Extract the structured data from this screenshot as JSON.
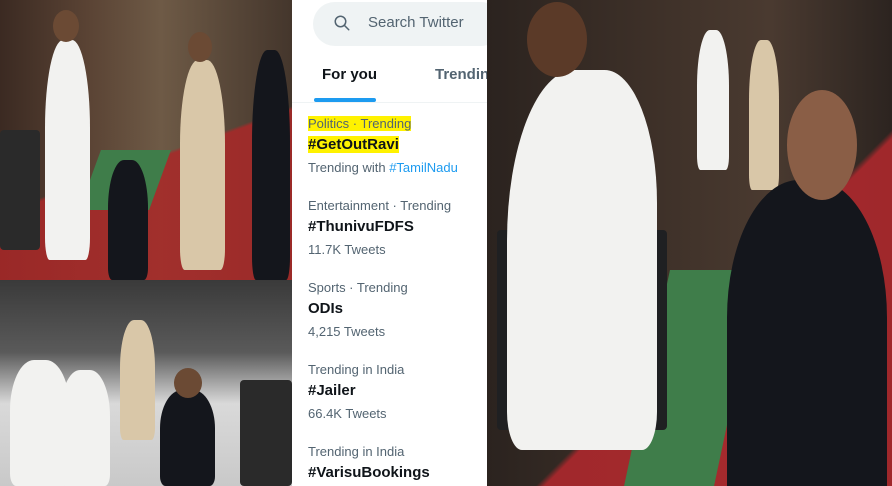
{
  "search": {
    "placeholder": "Search Twitter",
    "icon": "search-icon"
  },
  "tabs": [
    {
      "label": "For you",
      "active": true
    },
    {
      "label": "Trendin",
      "active": false
    }
  ],
  "trends": [
    {
      "category": "Politics · Trending",
      "name": "#GetOutRavi",
      "meta_prefix": "Trending with",
      "meta_link": "#TamilNadu",
      "highlighted": true
    },
    {
      "category": "Entertainment · Trending",
      "name": "#ThunivuFDFS",
      "meta": "11.7K Tweets"
    },
    {
      "category": "Sports · Trending",
      "name": "ODIs",
      "meta": "4,215 Tweets"
    },
    {
      "category": "Trending in India",
      "name": "#Jailer",
      "meta": "66.4K Tweets"
    },
    {
      "category": "Trending in India",
      "name": "#VarisuBookings"
    }
  ],
  "colors": {
    "accent": "#1d9bf0",
    "text_primary": "#0f1419",
    "text_secondary": "#536471",
    "highlight": "#fff200"
  }
}
